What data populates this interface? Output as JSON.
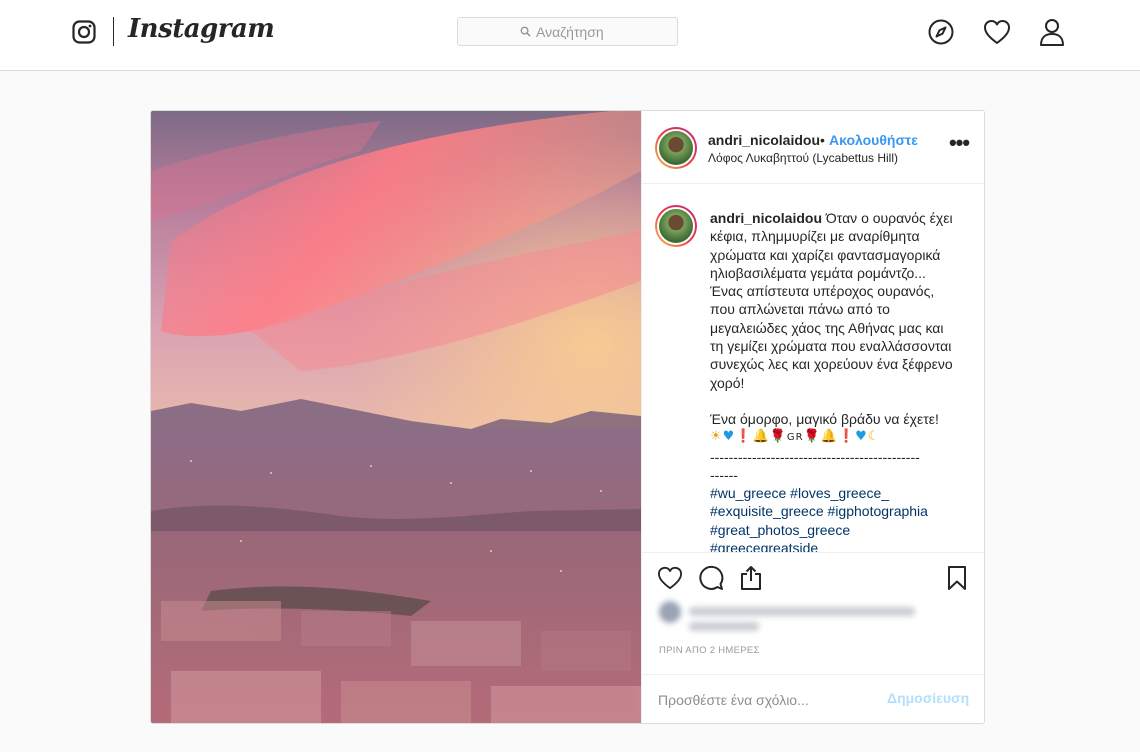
{
  "brand": {
    "wordmark": "Instagram"
  },
  "header": {
    "search_placeholder": "Αναζήτηση",
    "icons": [
      "instagram-glyph-icon",
      "search-icon",
      "explore-compass-icon",
      "activity-heart-icon",
      "profile-icon"
    ]
  },
  "post": {
    "author": {
      "username": "andri_nicolaidou",
      "separator": "•",
      "follow_label": "Ακολουθήστε",
      "location": "Λόφος Λυκαβηττού (Lycabettus Hill)"
    },
    "more_label": "•••",
    "caption": {
      "username": "andri_nicolaidou",
      "text": "Όταν ο ουρανός έχει κέφια, πλημμυρίζει με αναρίθμητα χρώματα και χαρίζει φαντασμαγορικά ηλιοβασιλέματα γεμάτα ρομάντζο... Ένας απίστευτα υπέροχος ουρανός, που απλώνεται πάνω από το μεγαλειώδες χάος της Αθήνας μας και τη γεμίζει χρώματα που εναλλάσσονται συνεχώς λες και χορεύουν ένα ξέφρενο χορό!",
      "wish": "Ένα όμορφο, μαγικό βράδυ να έχετε!",
      "emojis": {
        "sun": "☀",
        "heart": "♥",
        "excl": "❗",
        "bell": "🔔",
        "rose": "🌹",
        "flag": "GR",
        "moon": "☾"
      },
      "divider": "---------------------------------------------",
      "divider_tail": "------",
      "hashtags": [
        "#wu_greece",
        "#loves_greece_",
        "#exquisite_greece",
        "#igphotographia",
        "#great_photos_greece",
        "#greecegreatside"
      ]
    },
    "actions": {
      "icons": [
        "like-heart-icon",
        "comment-bubble-icon",
        "share-icon",
        "save-bookmark-icon"
      ]
    },
    "timestamp": "ΠΡΙΝ ΑΠΟ 2 ΗΜΕΡΕΣ",
    "comment_placeholder": "Προσθέστε ένα σχόλιο...",
    "post_button": "Δημοσίευση"
  }
}
